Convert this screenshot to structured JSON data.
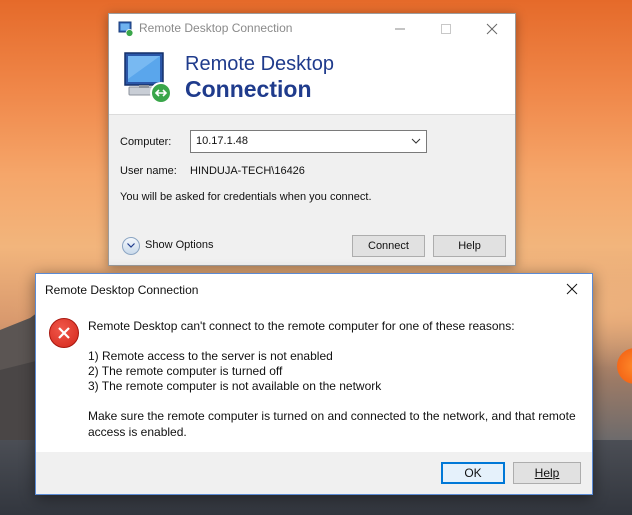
{
  "rdp_window": {
    "title": "Remote Desktop Connection",
    "banner_line1": "Remote Desktop",
    "banner_line2": "Connection",
    "computer_label": "Computer:",
    "computer_value": "10.17.1.48",
    "username_label": "User name:",
    "username_value": "HINDUJA-TECH\\16426",
    "credentials_note": "You will be asked for credentials when you connect.",
    "show_options_label": "Show Options",
    "connect_label": "Connect",
    "help_label": "Help"
  },
  "error_dialog": {
    "title": "Remote Desktop Connection",
    "message_intro": "Remote Desktop can't connect to the remote computer for one of these reasons:",
    "reasons": [
      "1) Remote access to the server is not enabled",
      "2) The remote computer is turned off",
      "3) The remote computer is not available on the network"
    ],
    "advice_line1": "Make sure the remote computer is turned on and connected to the network, and that remote",
    "advice_line2": "access is enabled.",
    "ok_label": "OK",
    "help_label": "Help"
  },
  "colors": {
    "banner_text": "#1f3b8c",
    "error_red": "#d4271b",
    "default_button_border": "#0078d7"
  },
  "icons": [
    "remote-desktop-icon",
    "minimize-icon",
    "maximize-icon",
    "close-icon",
    "chevron-down-icon",
    "expand-options-icon",
    "error-icon"
  ]
}
